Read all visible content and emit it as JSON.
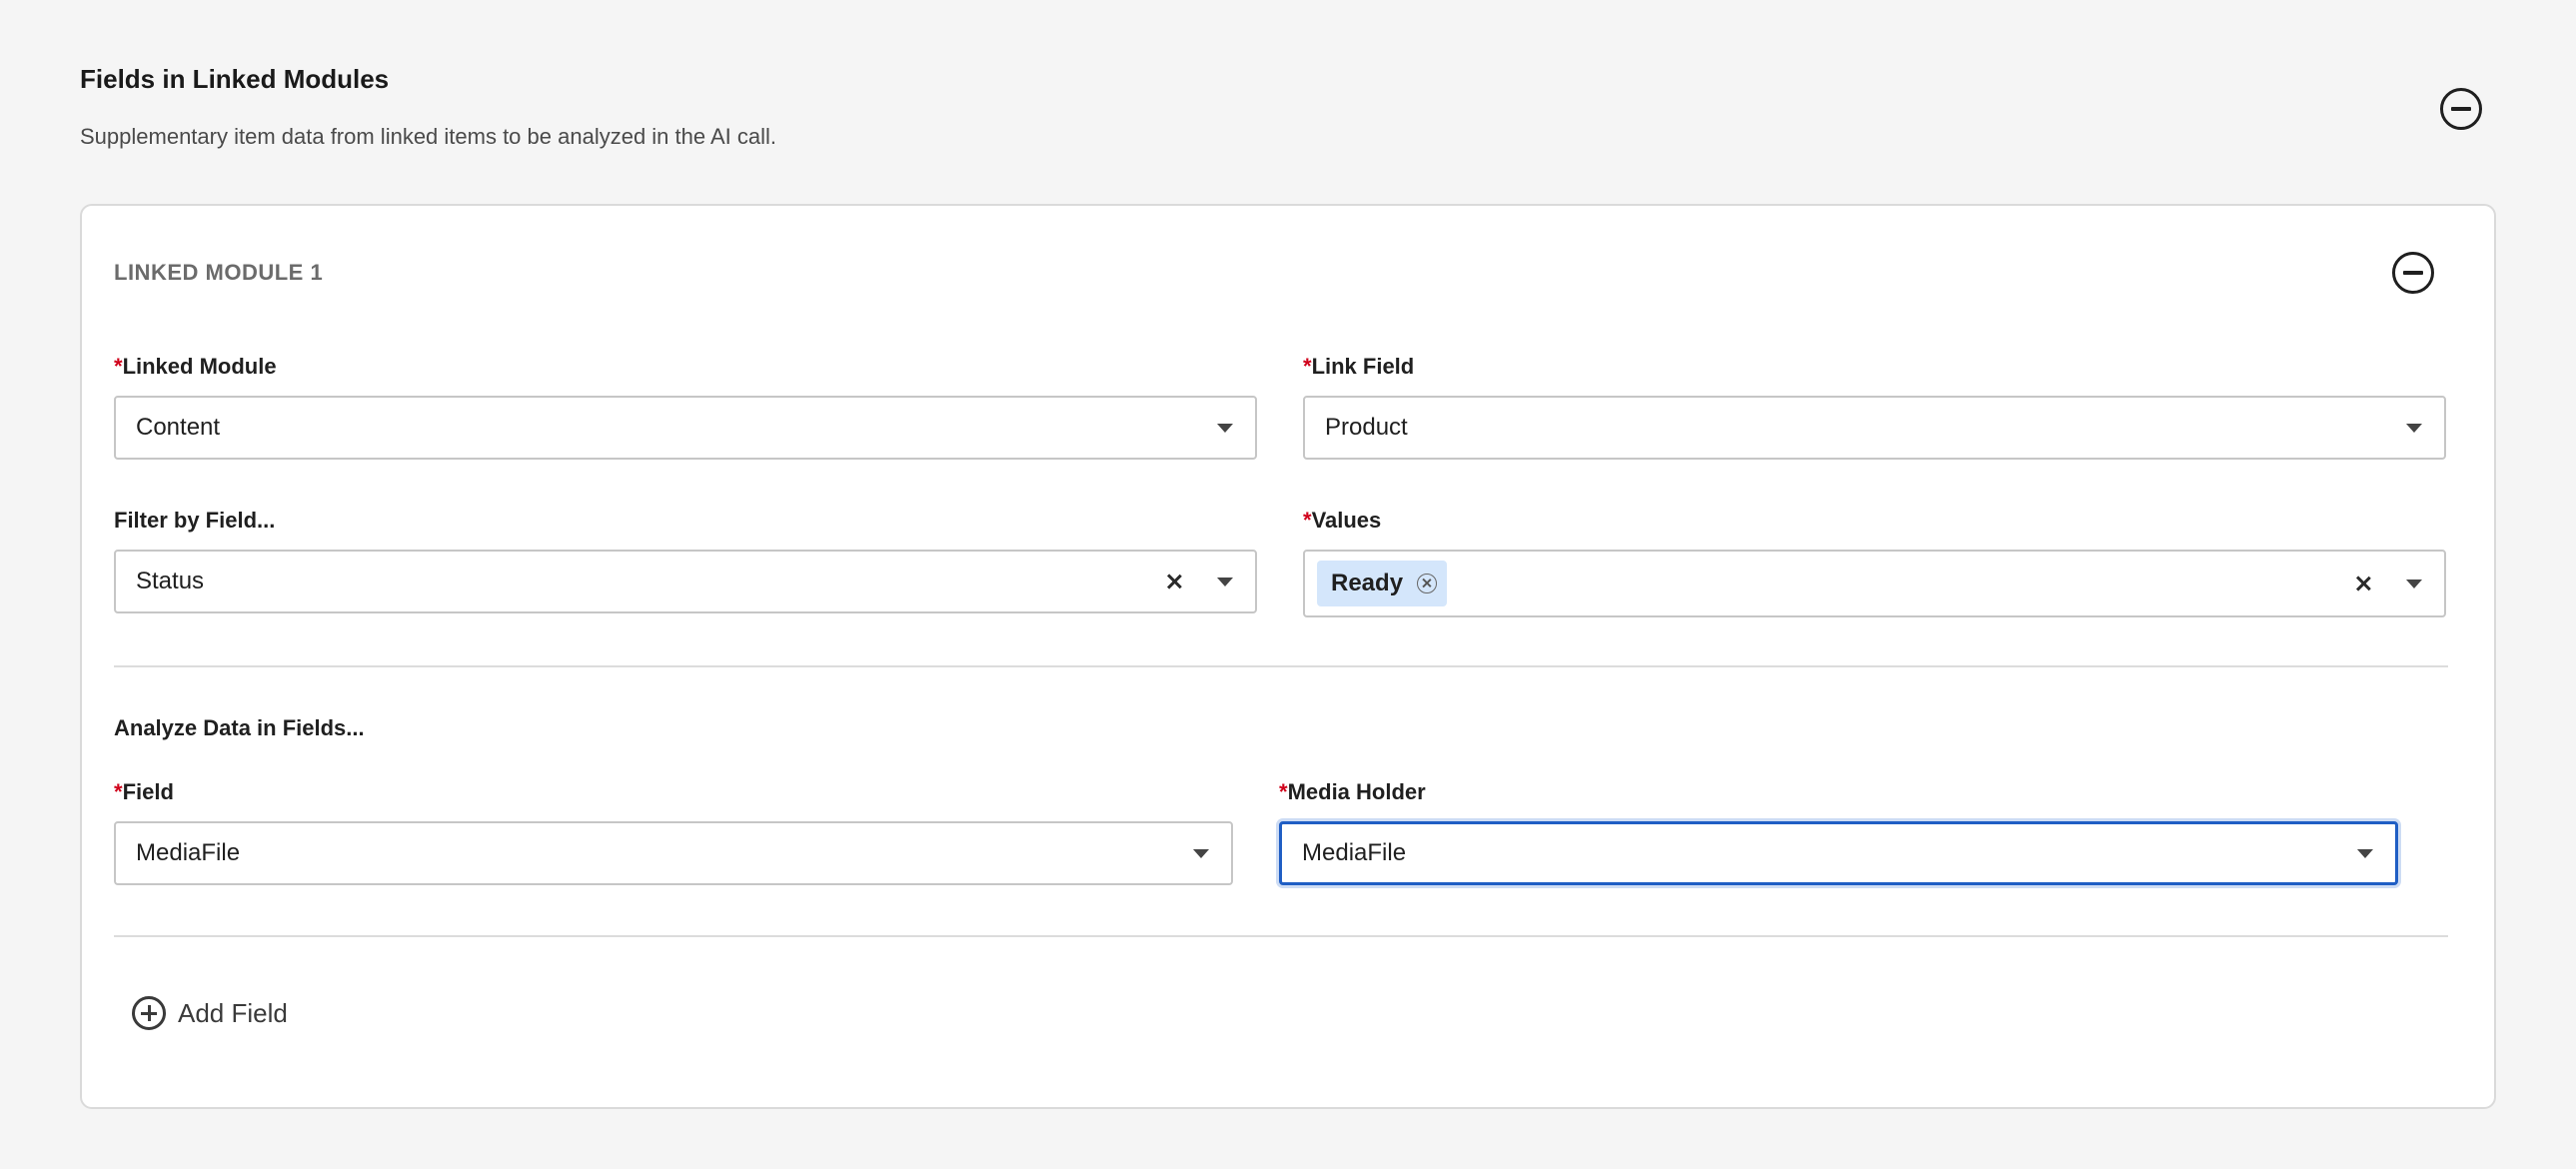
{
  "section": {
    "title": "Fields in Linked Modules",
    "description": "Supplementary item data from linked items to be analyzed in the AI call.",
    "collapse_icon": "circle-minus-icon"
  },
  "module": {
    "title": "LINKED MODULE 1",
    "collapse_icon": "circle-minus-icon",
    "linked_module": {
      "label": "Linked Module",
      "required": "*",
      "value": "Content"
    },
    "link_field": {
      "label": "Link Field",
      "required": "*",
      "value": "Product"
    },
    "filter_by_field": {
      "label": "Filter by Field...",
      "value": "Status"
    },
    "values": {
      "label": "Values",
      "required": "*",
      "chips": [
        "Ready"
      ]
    },
    "analyze_heading": "Analyze Data in Fields...",
    "field": {
      "label": "Field",
      "required": "*",
      "value": "MediaFile"
    },
    "media_holder": {
      "label": "Media Holder",
      "required": "*",
      "value": "MediaFile"
    },
    "add_field_label": "Add Field",
    "add_field_icon": "circle-plus-icon"
  },
  "colors": {
    "required": "#d0021b",
    "focus": "#1f5ec4",
    "chip_bg": "#d4e6fb"
  }
}
